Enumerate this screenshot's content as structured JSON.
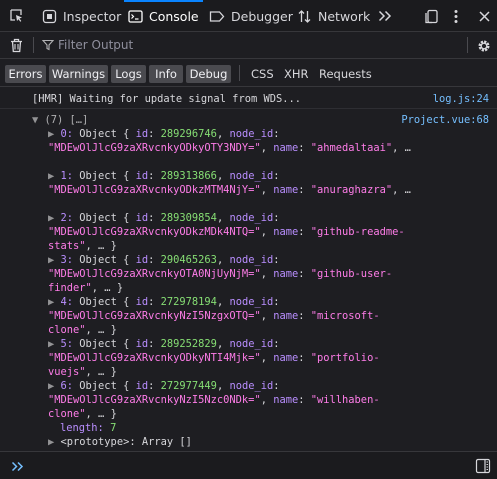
{
  "toolbar": {
    "tabs": [
      {
        "label": "Inspector"
      },
      {
        "label": "Console"
      },
      {
        "label": "Debugger"
      },
      {
        "label": "Network"
      }
    ]
  },
  "filter": {
    "placeholder": "Filter Output"
  },
  "levels": [
    "Errors",
    "Warnings",
    "Logs",
    "Info",
    "Debug"
  ],
  "categories": [
    "CSS",
    "XHR",
    "Requests"
  ],
  "console": {
    "hmr_message": "[HMR] Waiting for update signal from WDS...",
    "hmr_source": "log.js:24",
    "array_header": "(7) […]",
    "array_source": "Project.vue:68",
    "items": [
      {
        "index": "0:",
        "id": "289296746",
        "node_id_a": "\"MDEwOlJlcG9zaXRvcnkyODkyOTY3NDY=\"",
        "name_a": "\"ahmedaltaai\"",
        "tail_a": ", …",
        "name_b": "",
        "tail_b": ""
      },
      {
        "index": "1:",
        "id": "289313866",
        "node_id_a": "\"MDEwOlJlcG9zaXRvcnkyODkzMTM4NjY=\"",
        "name_a": "\"anuraghazra\"",
        "tail_a": ", …",
        "name_b": "",
        "tail_b": ""
      },
      {
        "index": "2:",
        "id": "289309854",
        "node_id_a": "\"MDEwOlJlcG9zaXRvcnkyODkzMDk4NTQ=\"",
        "name_a": "\"github-readme-",
        "tail_a": "",
        "name_b": "stats\"",
        "tail_b": ", … }"
      },
      {
        "index": "3:",
        "id": "290465263",
        "node_id_a": "\"MDEwOlJlcG9zaXRvcnkyOTA0NjUyNjM=\"",
        "name_a": "\"github-user-",
        "tail_a": "",
        "name_b": "finder\"",
        "tail_b": ", … }"
      },
      {
        "index": "4:",
        "id": "272978194",
        "node_id_a": "\"MDEwOlJlcG9zaXRvcnkyNzI5NzgxOTQ=\"",
        "name_a": "\"microsoft-",
        "tail_a": "",
        "name_b": "clone\"",
        "tail_b": ", … }"
      },
      {
        "index": "5:",
        "id": "289252829",
        "node_id_a": "\"MDEwOlJlcG9zaXRvcnkyODkyNTI4Mjk=\"",
        "name_a": "\"portfolio-",
        "tail_a": "",
        "name_b": "vuejs\"",
        "tail_b": ", … }"
      },
      {
        "index": "6:",
        "id": "272977449",
        "node_id_a": "\"MDEwOlJlcG9zaXRvcnkyNzI5Nzc0NDk=\"",
        "name_a": "\"willhaben-",
        "tail_a": "",
        "name_b": "clone\"",
        "tail_b": ", … }"
      }
    ],
    "length_label": "length:",
    "length_value": "7",
    "prototype_label": "<prototype>: Array []"
  },
  "colors": {
    "accent": "#0a84ff",
    "string": "#ff7de9",
    "number": "#86de74",
    "key": "#b98eff",
    "link": "#75bfff"
  }
}
